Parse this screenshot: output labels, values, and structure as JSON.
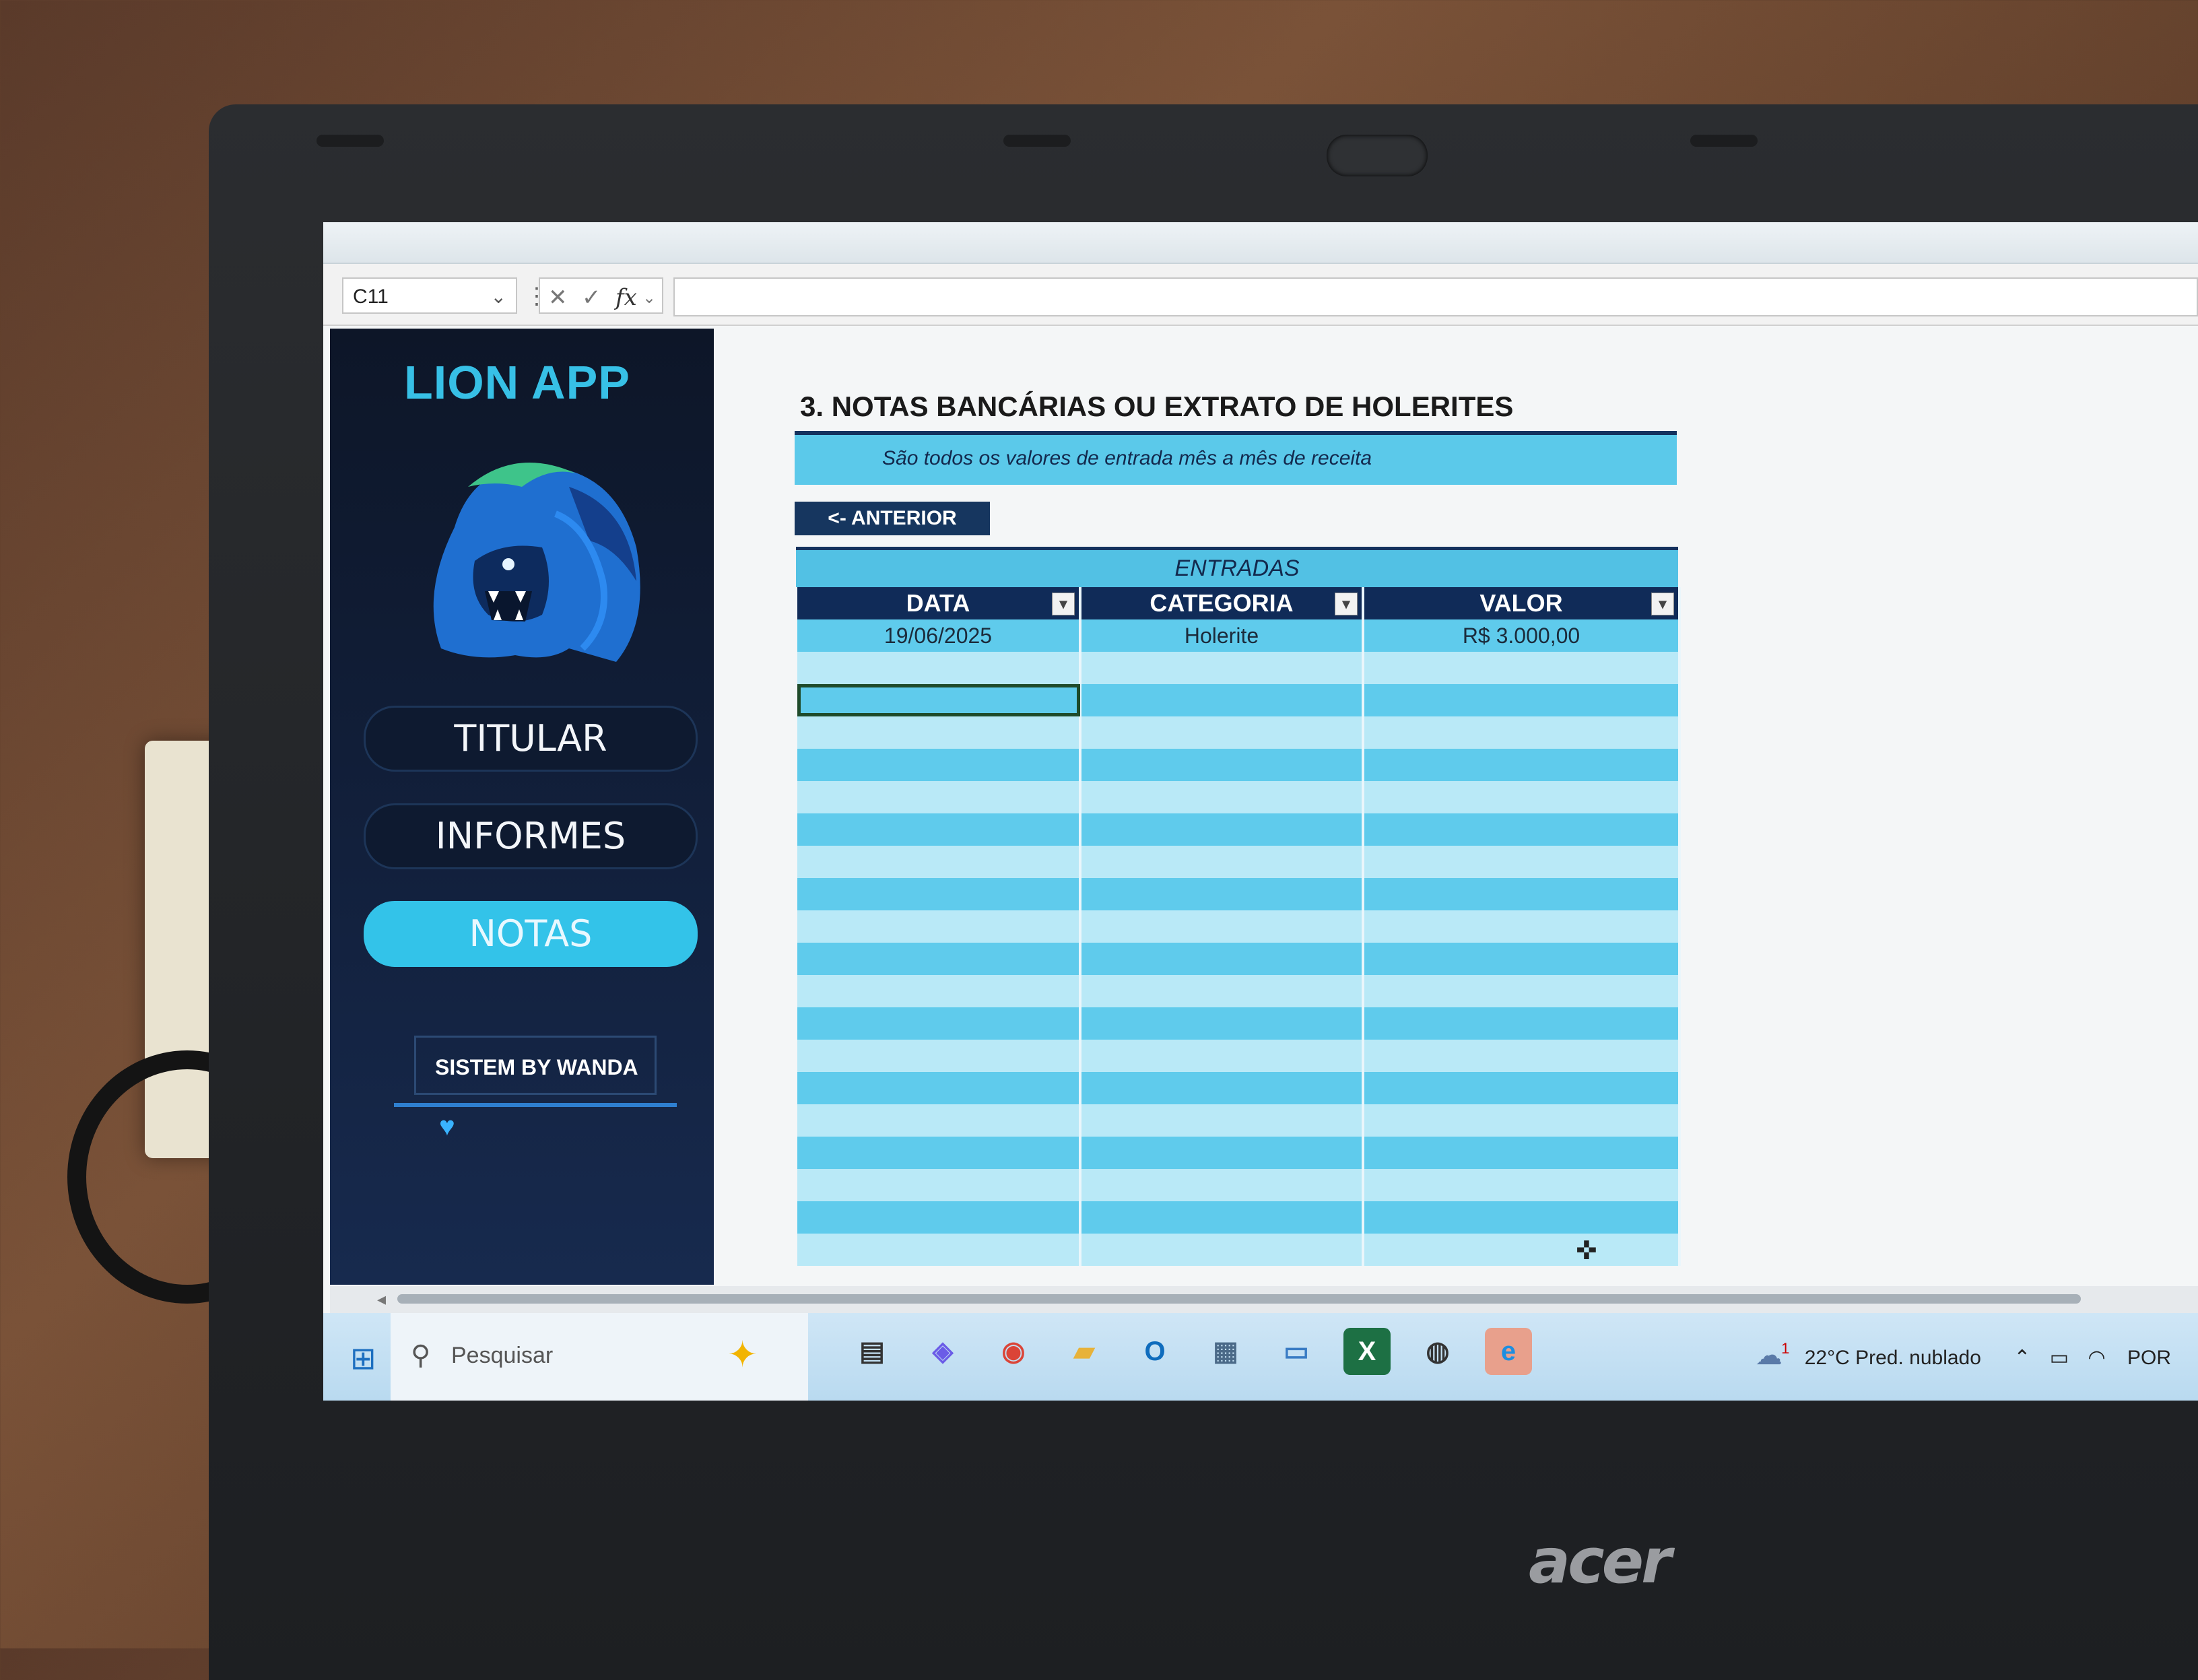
{
  "formula_bar": {
    "name_box": "C11",
    "icons": [
      "chevron-down-icon",
      "cancel-icon",
      "check-icon",
      "fx-icon"
    ],
    "fx_label": "fx",
    "formula": ""
  },
  "sidebar": {
    "app_title": "LION APP",
    "logo": "lion-head-logo",
    "nav": [
      {
        "label": "TITULAR",
        "active": false
      },
      {
        "label": "INFORMES",
        "active": false
      },
      {
        "label": "NOTAS",
        "active": true
      }
    ],
    "credit": "SISTEM BY WANDA",
    "credit_icon": "heart-icon"
  },
  "sheet": {
    "section_title": "3. NOTAS BANCÁRIAS OU EXTRATO DE HOLERITES",
    "section_subtitle": "São todos os valores de entrada mês a mês de receita",
    "back_button": "<- ANTERIOR",
    "table_title": "ENTRADAS",
    "columns": [
      "DATA",
      "CATEGORIA",
      "VALOR"
    ],
    "rows": [
      [
        "19/06/2025",
        "Holerite",
        "R$ 3.000,00"
      ]
    ],
    "empty_rows": 19,
    "selected_cell": "C11"
  },
  "taskbar": {
    "search_placeholder": "Pesquisar",
    "apps": [
      "task-view-icon",
      "copilot-icon",
      "chrome-icon",
      "file-explorer-icon",
      "outlook-icon",
      "calculator-icon",
      "remote-desktop-icon",
      "excel-icon",
      "webcam-icon",
      "edge-icon"
    ],
    "weather": "22°C  Pred. nublado",
    "weather_badge": "1",
    "language": "POR"
  },
  "device": {
    "brand": "acer"
  },
  "colors": {
    "accent": "#33c3e9",
    "navy": "#102b58",
    "sidebar_bg": "#0d1628",
    "row_dark": "#5fcbec",
    "row_light": "#b9e9f7"
  }
}
